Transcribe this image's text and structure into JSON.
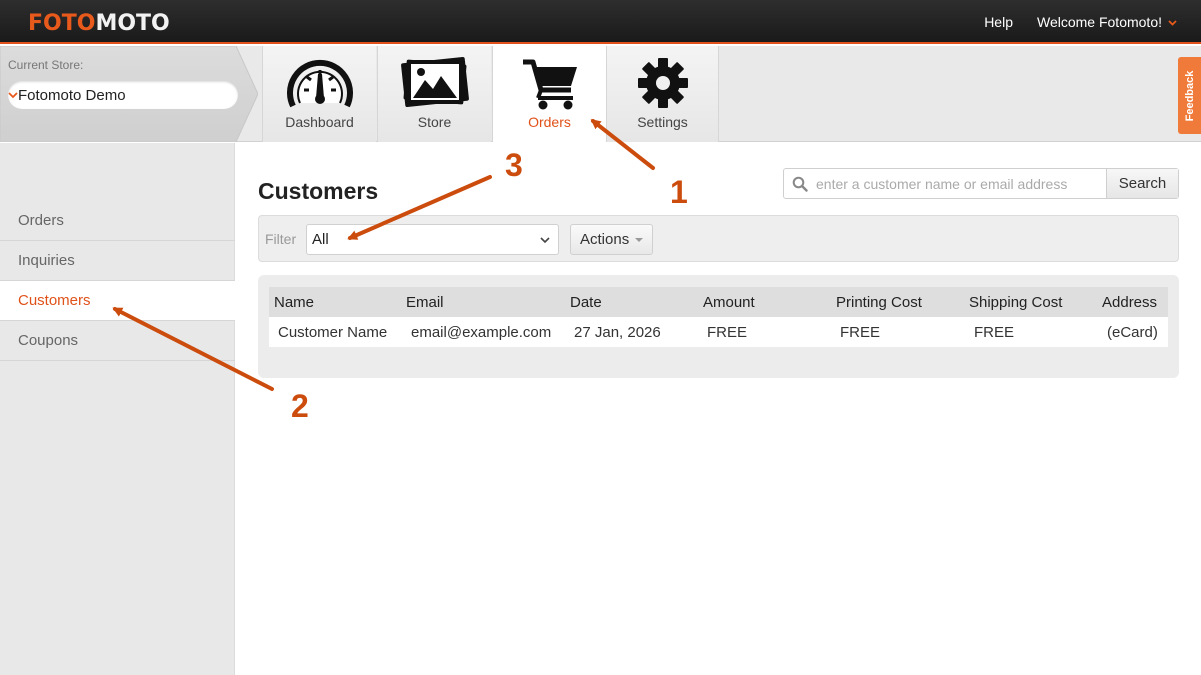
{
  "topbar": {
    "logo_part1": "FOTO",
    "logo_part2": "MOTO",
    "help_label": "Help",
    "welcome_label": "Welcome Fotomoto!",
    "chevron_glyph": "⌄"
  },
  "store": {
    "label": "Current Store:",
    "selected": "Fotomoto Demo",
    "chevron_glyph": "⌄"
  },
  "tabs": [
    {
      "label": "Dashboard",
      "icon": "speedometer-icon",
      "active": false
    },
    {
      "label": "Store",
      "icon": "photos-icon",
      "active": false
    },
    {
      "label": "Orders",
      "icon": "cart-icon",
      "active": true
    },
    {
      "label": "Settings",
      "icon": "gear-icon",
      "active": false
    }
  ],
  "feedback_label": "Feedback",
  "sidebar": {
    "items": [
      {
        "label": "Orders",
        "active": false
      },
      {
        "label": "Inquiries",
        "active": false
      },
      {
        "label": "Customers",
        "active": true
      },
      {
        "label": "Coupons",
        "active": false
      }
    ]
  },
  "main": {
    "title": "Customers",
    "search": {
      "placeholder": "enter a customer name or email address",
      "value": "",
      "button_label": "Search"
    },
    "filter": {
      "label": "Filter",
      "value": "All"
    },
    "actions_label": "Actions",
    "table": {
      "headers": [
        "Name",
        "Email",
        "Date",
        "Amount",
        "Printing Cost",
        "Shipping Cost",
        "Address"
      ],
      "rows": [
        [
          "Customer Name",
          "email@example.com",
          "27 Jan, 2026",
          "FREE",
          "FREE",
          "FREE",
          "(eCard)"
        ]
      ]
    }
  },
  "annotations": {
    "labels": [
      "1",
      "2",
      "3"
    ],
    "color": "#cc4c0e"
  },
  "colors": {
    "accent": "#e0521a",
    "topbar": "#1a1a1a"
  }
}
